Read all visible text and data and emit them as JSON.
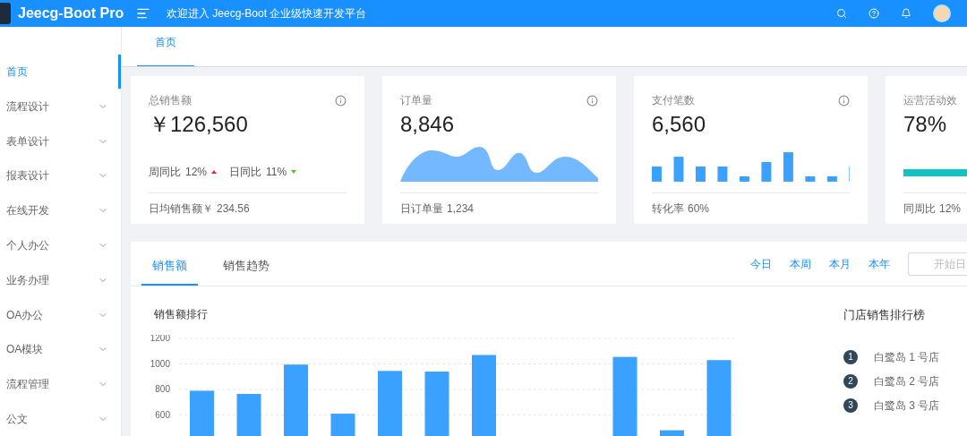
{
  "header": {
    "app_name": "Jeecg-Boot Pro",
    "welcome": "欢迎进入 Jeecg-Boot 企业级快速开发平台"
  },
  "sidebar": {
    "items": [
      {
        "label": "首页",
        "selected": true,
        "has_children": false
      },
      {
        "label": "流程设计",
        "selected": false,
        "has_children": true
      },
      {
        "label": "表单设计",
        "selected": false,
        "has_children": true
      },
      {
        "label": "报表设计",
        "selected": false,
        "has_children": true
      },
      {
        "label": "在线开发",
        "selected": false,
        "has_children": true
      },
      {
        "label": "个人办公",
        "selected": false,
        "has_children": true
      },
      {
        "label": "业务办理",
        "selected": false,
        "has_children": true
      },
      {
        "label": "OA办公",
        "selected": false,
        "has_children": true
      },
      {
        "label": "OA模块",
        "selected": false,
        "has_children": true
      },
      {
        "label": "流程管理",
        "selected": false,
        "has_children": true
      },
      {
        "label": "公文",
        "selected": false,
        "has_children": true
      }
    ]
  },
  "page_tabs": [
    {
      "label": "首页",
      "selected": true
    }
  ],
  "stat_cards": [
    {
      "kind": "trend",
      "title": "总销售额",
      "value": "￥126,560",
      "trends": [
        {
          "label": "周同比",
          "value": "12%",
          "rising": true
        },
        {
          "label": "日同比",
          "value": "11%",
          "rising": false
        }
      ],
      "footer_label": "日均销售额￥",
      "footer_value": "234.56",
      "info": true
    },
    {
      "kind": "area",
      "title": "订单量",
      "value": "8,846",
      "footer_label": "日订单量",
      "footer_value": "1,234",
      "info": true
    },
    {
      "kind": "bars",
      "title": "支付笔数",
      "value": "6,560",
      "footer_label": "转化率",
      "footer_value": "60%",
      "info": true
    },
    {
      "kind": "progress",
      "title": "运营活动效",
      "value": "78%",
      "footer_label": "同周比",
      "footer_value": "12%",
      "info": false
    }
  ],
  "sales": {
    "tabs": [
      {
        "label": "销售额",
        "selected": true
      },
      {
        "label": "销售趋势",
        "selected": false
      }
    ],
    "periods": [
      "今日",
      "本周",
      "本月",
      "本年"
    ],
    "date_field": {
      "placeholder": "开始日"
    },
    "chart_title": "销售额排行",
    "chart_data": {
      "type": "bar",
      "grid": true,
      "ylim": [
        0,
        1200
      ],
      "yticks": [
        600,
        800,
        1000,
        1200
      ],
      "values": [
        790,
        765,
        995,
        610,
        945,
        940,
        1070,
        null,
        null,
        1055,
        480,
        1030
      ]
    },
    "ranking_title": "门店销售排行榜",
    "ranking": [
      {
        "rank": "1",
        "name": "白鹭岛 1 号店"
      },
      {
        "rank": "2",
        "name": "白鹭岛 2 号店"
      },
      {
        "rank": "3",
        "name": "白鹭岛 3 号店"
      }
    ]
  }
}
